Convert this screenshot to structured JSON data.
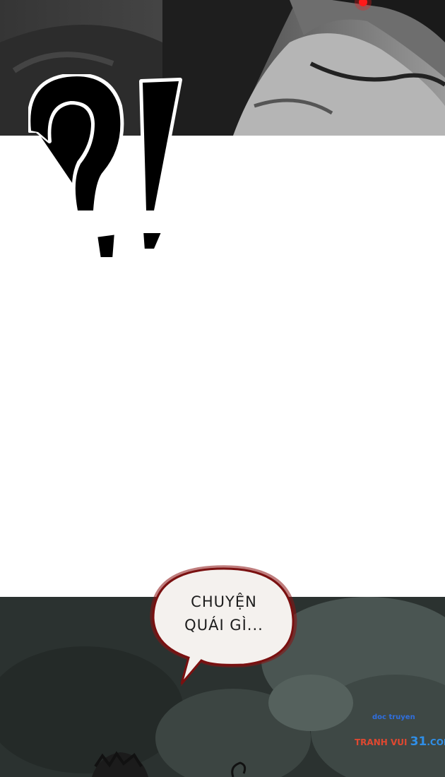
{
  "bubble": {
    "line1": "CHUYỆN",
    "line2": "QUÁI GÌ..."
  },
  "watermark": {
    "small": "doc truyen",
    "site_a": "TRANH VUI ",
    "site_b": "31",
    "site_c": ".COM"
  },
  "colors": {
    "bubble_outline": "#7a1010",
    "eye_red": "#ff1a1a",
    "panel_dark": "#2b3230"
  }
}
